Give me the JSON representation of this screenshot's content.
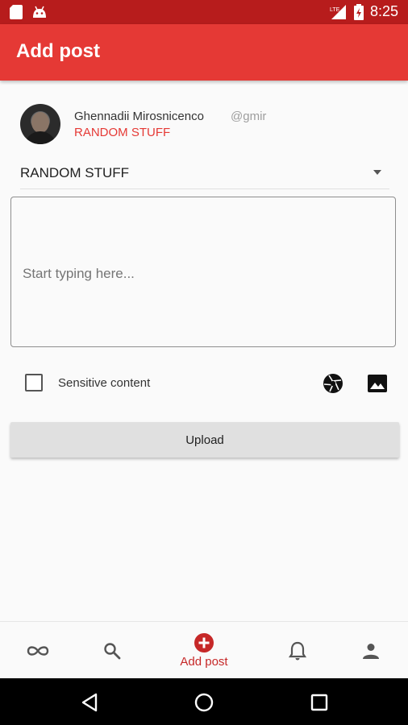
{
  "status_bar": {
    "time": "8:25",
    "network": "LTE"
  },
  "app_bar": {
    "title": "Add post"
  },
  "author": {
    "name": "Ghennadii Mirosnicenco",
    "handle": "@gmir",
    "category": "RANDOM STUFF"
  },
  "category_select": {
    "value": "RANDOM STUFF"
  },
  "post_input": {
    "placeholder": "Start typing here..."
  },
  "sensitive": {
    "label": "Sensitive content",
    "checked": false
  },
  "upload": {
    "label": "Upload"
  },
  "bottom_nav": {
    "items": [
      {
        "icon": "infinity-icon",
        "label": ""
      },
      {
        "icon": "search-icon",
        "label": ""
      },
      {
        "icon": "add-circle-icon",
        "label": "Add post",
        "active": true
      },
      {
        "icon": "bell-icon",
        "label": ""
      },
      {
        "icon": "person-icon",
        "label": ""
      }
    ]
  },
  "colors": {
    "primary": "#e53935",
    "primary_dark": "#b71c1c",
    "accent_text": "#c62828"
  }
}
